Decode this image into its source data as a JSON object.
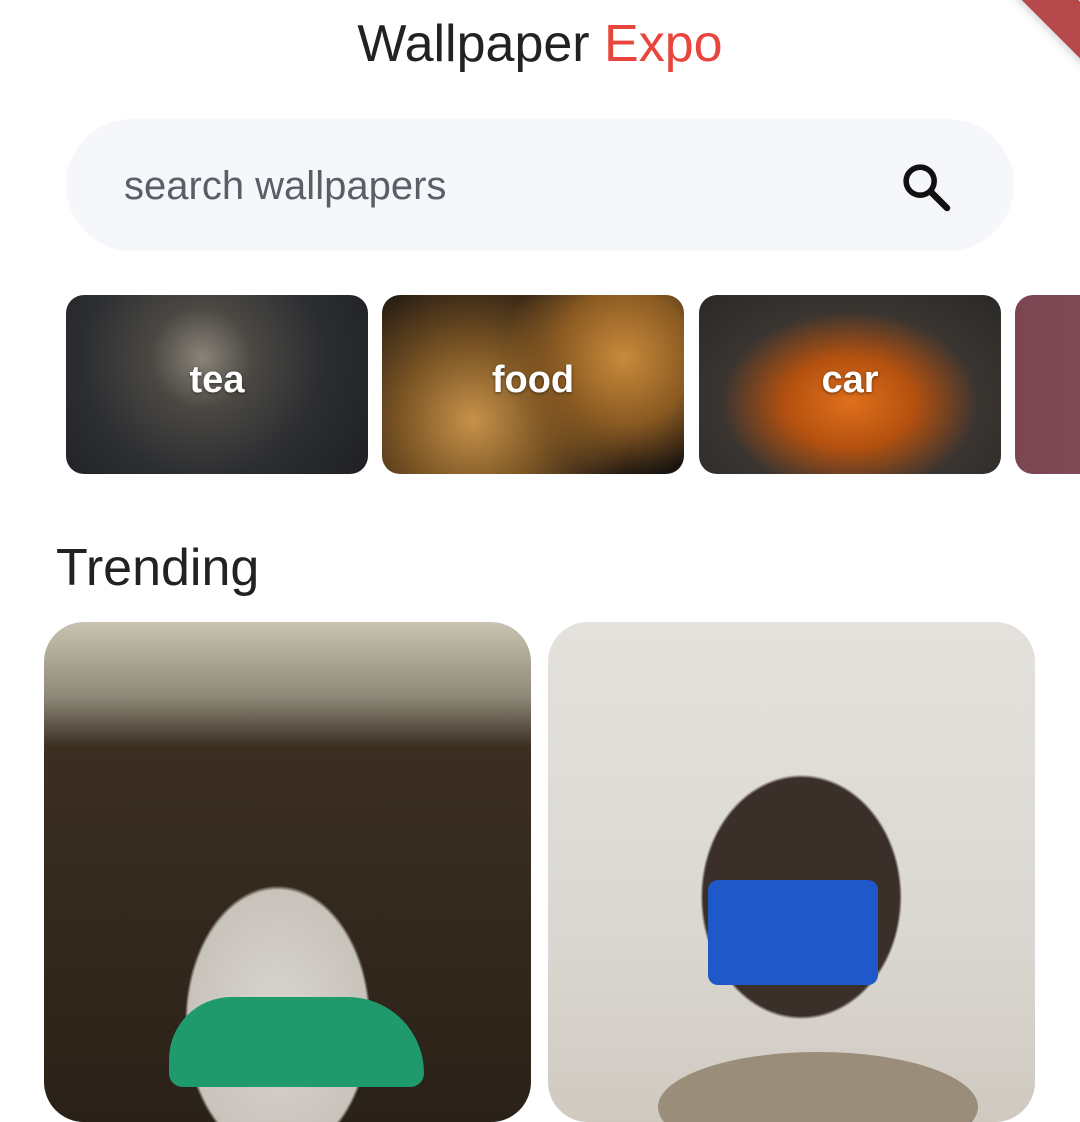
{
  "header": {
    "title_main": "Wallpaper",
    "title_accent": "Expo",
    "accent_color": "#e8453c"
  },
  "debug_banner": {
    "color": "#b5484a"
  },
  "search": {
    "placeholder": "search wallpapers",
    "value": "",
    "icon": "search-icon"
  },
  "categories": [
    {
      "label": "tea"
    },
    {
      "label": "food"
    },
    {
      "label": "car"
    },
    {
      "label": ""
    }
  ],
  "trending": {
    "heading": "Trending"
  }
}
